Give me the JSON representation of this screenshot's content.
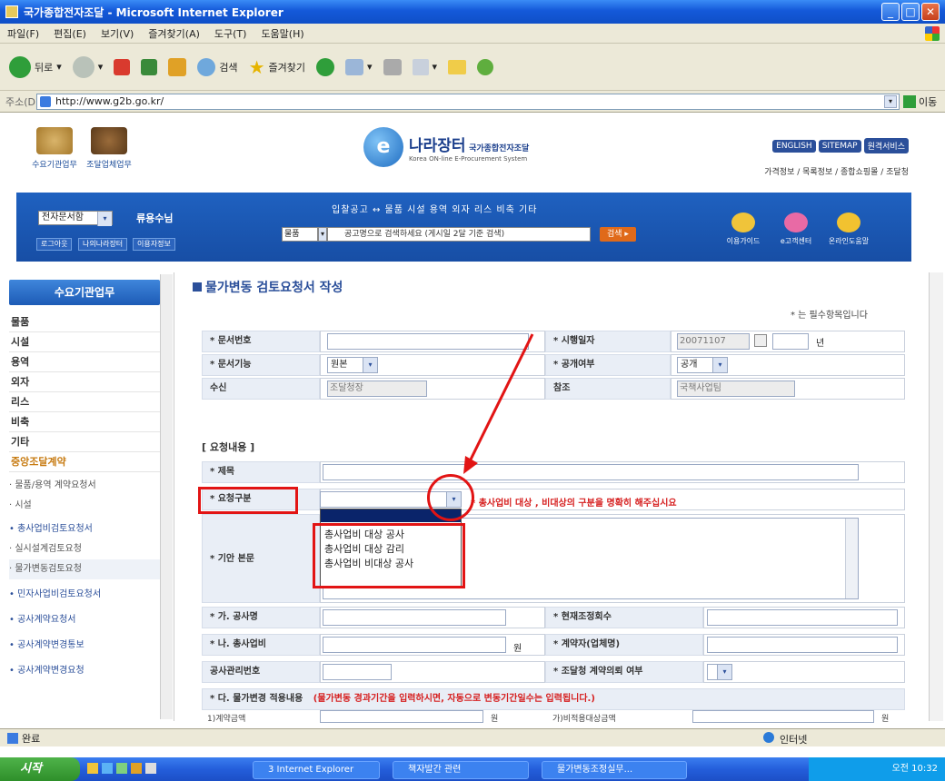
{
  "window": {
    "title": "국가종합전자조달 - Microsoft Internet Explorer"
  },
  "menubar": [
    "파일(F)",
    "편집(E)",
    "보기(V)",
    "즐겨찾기(A)",
    "도구(T)",
    "도움말(H)"
  ],
  "toolbar": {
    "back": "뒤로",
    "search": "검색",
    "favorites": "즐겨찾기"
  },
  "address": {
    "label": "주소(D)",
    "url": "http://www.g2b.go.kr/",
    "go": "이동"
  },
  "header": {
    "top_icons": [
      "수요기관업무",
      "조달업체업무"
    ],
    "logo_title": "나라장터",
    "logo_title2": "국가종합전자조달",
    "logo_sub": "Korea ON-line E-Procurement System",
    "top_links": [
      "ENGLISH",
      "SITEMAP",
      "원격서비스"
    ],
    "top_menu": "가격정보 / 목록정보 / 종합쇼핑몰 / 조달청",
    "doc_select": "전자문서함",
    "user": "류용수님",
    "small_buttons": [
      "로그아웃",
      "나의나라장터",
      "이용자정보"
    ],
    "band_menu": "입찰공고 ↔  물품  시설  용역  외자  리스  비축  기타",
    "category": "물품",
    "search_placeholder": "공고명으로 검색하세요 (게시일 2달 기준 검색)",
    "search_btn": "검색 ▸",
    "band_icons": [
      "이용가이드",
      "e고객센터",
      "온라인도움말"
    ]
  },
  "sidebar": {
    "head": "수요기관업무",
    "items": [
      "물품",
      "시설",
      "용역",
      "외자",
      "리스",
      "비축",
      "기타"
    ],
    "highlight": "중앙조달계약",
    "sub_items": [
      "· 물품/용역 계약요청서",
      "· 시설",
      "  • 총사업비검토요청서",
      "  · 실시설계검토요청",
      "  · 물가변동검토요청",
      "  • 민자사업비검토요청서",
      "  • 공사계약요청서",
      "  • 공사계약변경통보",
      "  • 공사계약변경요청"
    ]
  },
  "form": {
    "title": "물가변동 검토요청서 작성",
    "required_note": "* 는 필수항목입니다",
    "labels": {
      "doc_no": "* 문서번호",
      "exec_date": "* 시행일자",
      "doc_func": "* 문서기능",
      "public": "* 공개여부",
      "recipient": "수신",
      "cc": "참조",
      "section": "[ 요청내용 ]",
      "subject": "* 제목",
      "req_type": "* 요청구분",
      "body": "* 기안 본문",
      "ga": "* 가. 공사명",
      "adj_count": "* 현재조정회수",
      "na": "* 나. 총사업비",
      "contractor": "* 계약자(업체명)",
      "mgmt_no": "공사관리번호",
      "proc_request": "* 조달청 계약의뢰 여부",
      "da": "* 다. 물가변경 적용내용"
    },
    "values": {
      "exec_date": "20071107",
      "year_unit": "년",
      "doc_func": "원본",
      "public": "공개",
      "recipient": "조달청장",
      "cc": "국책사업팀",
      "won_unit": "원"
    },
    "hint": "* 총사업비 대상 , 비대상의 구분을 명확히 해주십시요",
    "dropdown_options": [
      "총사업비 대상 공사",
      "총사업비 대상 감리",
      "총사업비 비대상 공사"
    ],
    "da_note": "(물가변동 경과기간을 입력하시면, 자동으로 변동기간일수는 입력됩니다.)",
    "bottom_row": [
      "1)계약금액",
      "원",
      "가)비적용대상금액",
      "원"
    ]
  },
  "status": {
    "done": "완료",
    "zone": "인터넷"
  },
  "taskbar": {
    "start": "시작",
    "items": [
      "3 Internet Explorer",
      "책자발간 관련",
      "물가변동조정실무..."
    ],
    "clock": "오전 10:32"
  },
  "colors": {
    "accent": "#1f61c0",
    "annotation": "#e21414",
    "hint": "#d62020"
  }
}
